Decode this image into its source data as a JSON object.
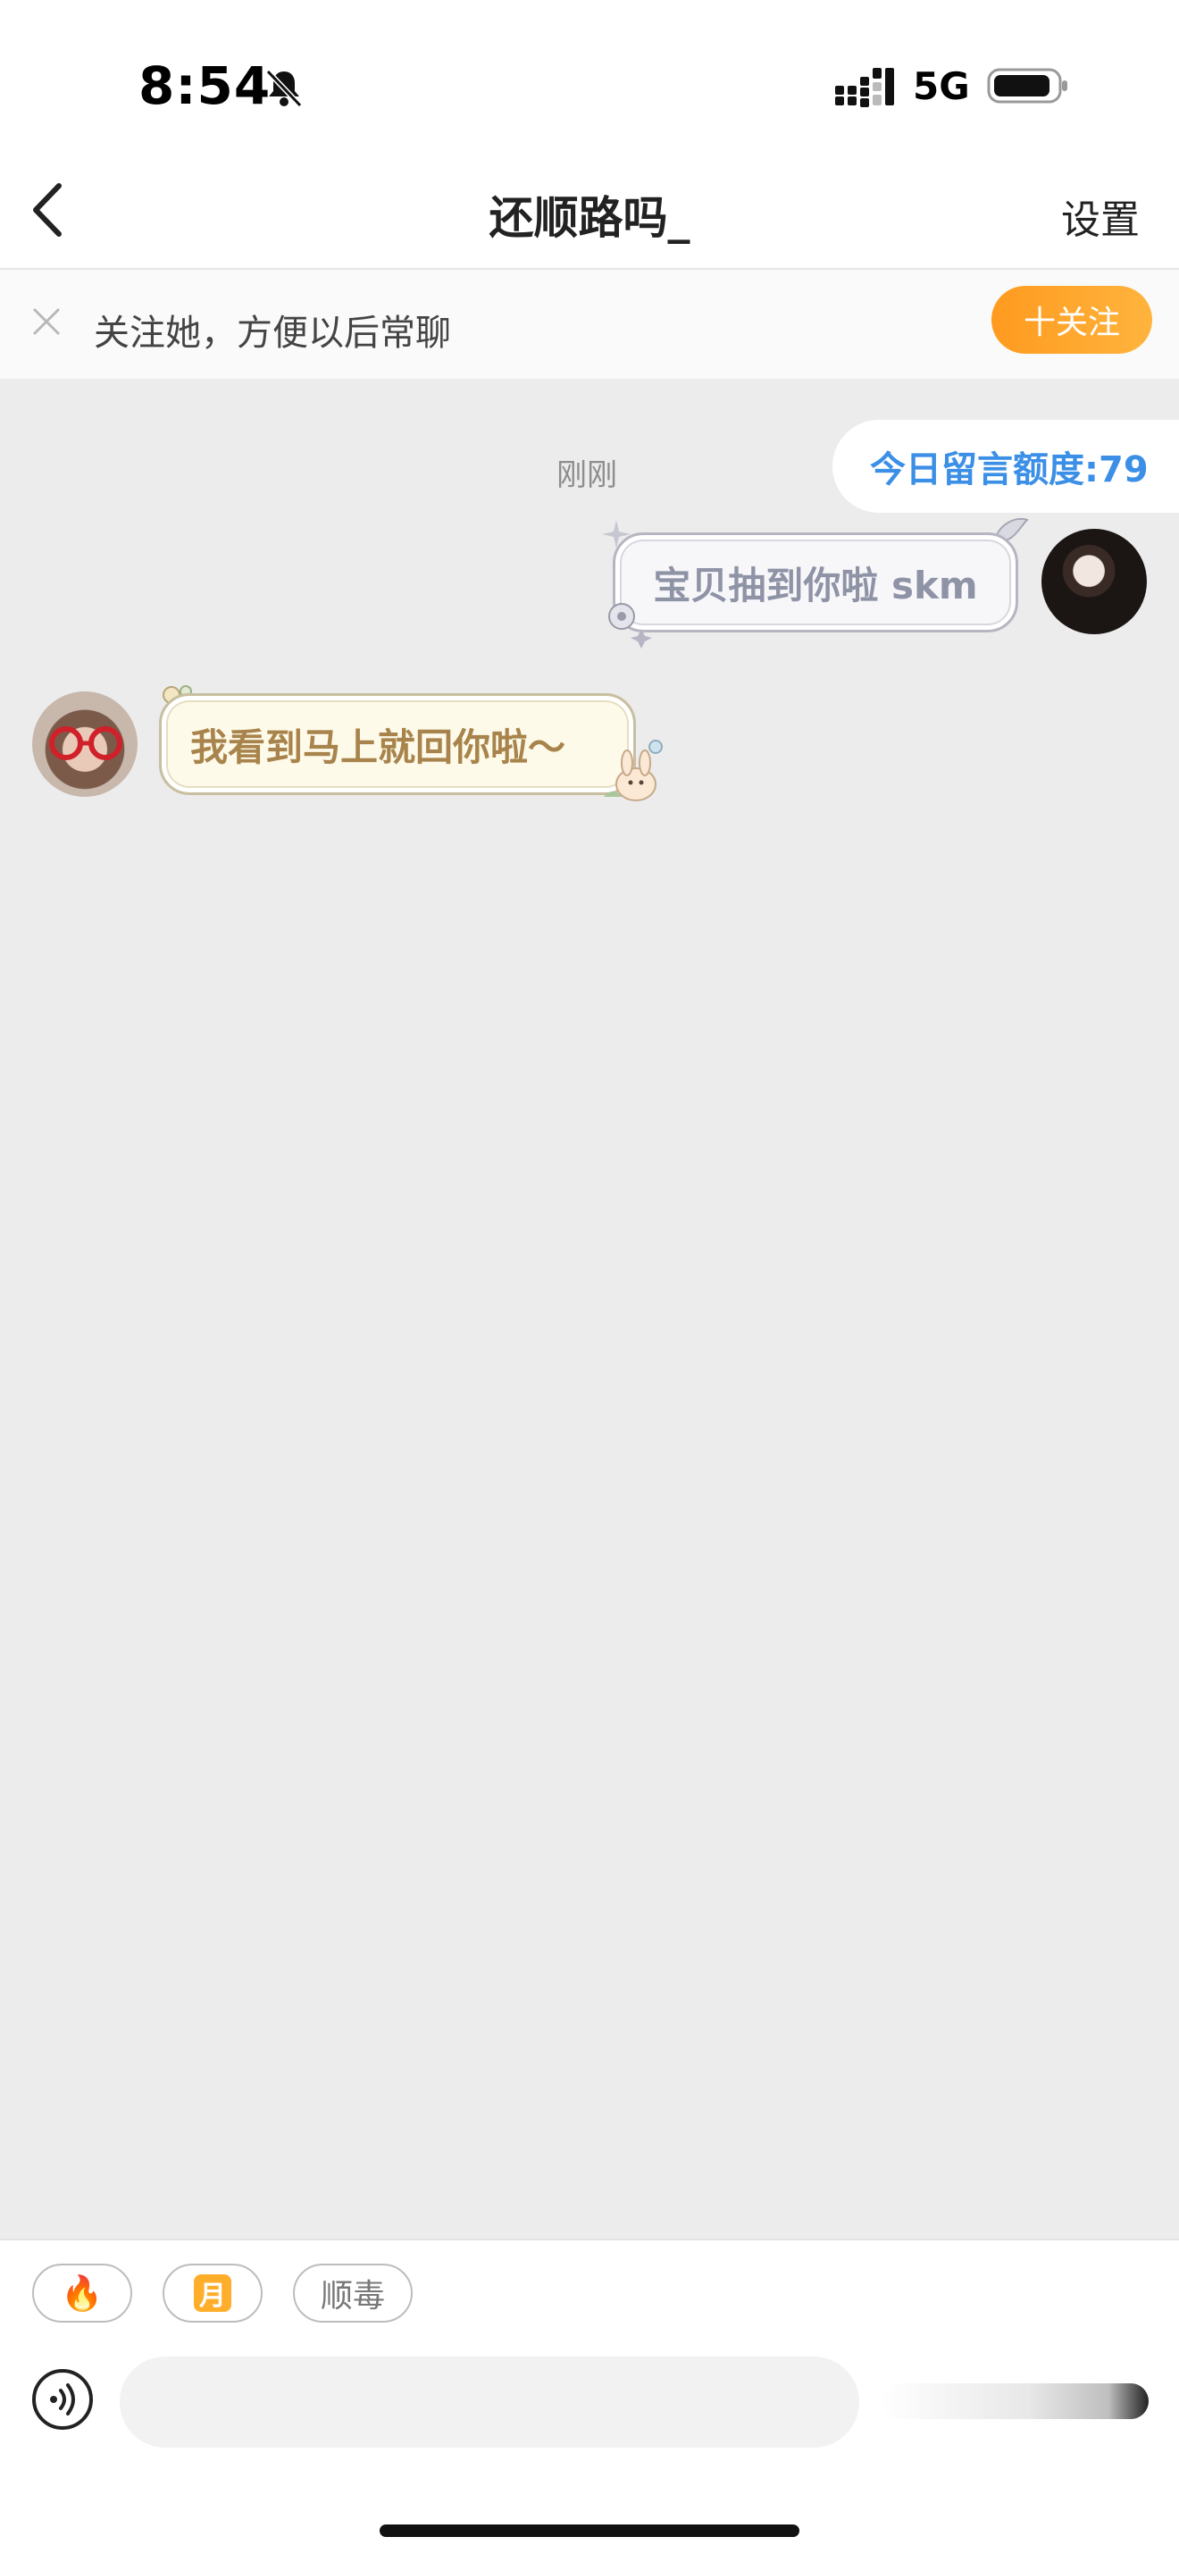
{
  "status_bar": {
    "time": "8:54",
    "network": "5G"
  },
  "nav": {
    "title": "还顺路吗_",
    "settings_label": "设置"
  },
  "follow_banner": {
    "text": "关注她，方便以后常聊",
    "button_label": "十关注"
  },
  "chat": {
    "quota_label": "今日留言额度:79",
    "timestamp": "刚刚",
    "messages": [
      {
        "side": "right",
        "text": "宝贝抽到你啦 skm"
      },
      {
        "side": "left",
        "text": "我看到马上就回你啦～"
      }
    ]
  },
  "quick_chips": [
    {
      "icon": "fire-icon",
      "label": "🔥"
    },
    {
      "icon": "moon-icon",
      "label": "月"
    },
    {
      "icon": "",
      "label": "顺毒"
    }
  ],
  "colors": {
    "accent_orange": "#ff9a1f",
    "quota_blue": "#3b8fe6",
    "chat_bg": "#ececec"
  }
}
